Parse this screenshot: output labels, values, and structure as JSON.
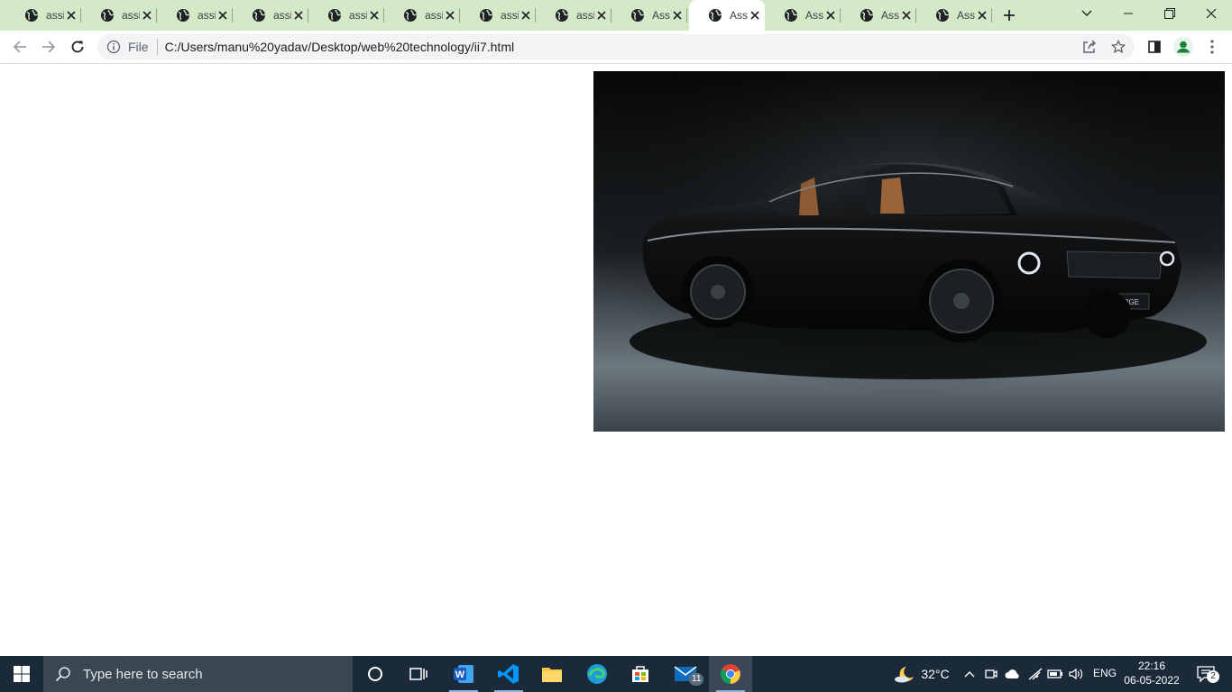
{
  "browser": {
    "tabs": [
      {
        "label": "assi",
        "active": false
      },
      {
        "label": "assi",
        "active": false
      },
      {
        "label": "assi",
        "active": false
      },
      {
        "label": "assi",
        "active": false
      },
      {
        "label": "assi",
        "active": false
      },
      {
        "label": "assi",
        "active": false
      },
      {
        "label": "assi",
        "active": false
      },
      {
        "label": "assi",
        "active": false
      },
      {
        "label": "Ass",
        "active": false
      },
      {
        "label": "Ass",
        "active": true
      },
      {
        "label": "Ass",
        "active": false
      },
      {
        "label": "Ass",
        "active": false
      },
      {
        "label": "Ass",
        "active": false
      }
    ],
    "address": {
      "scheme_label": "File",
      "url": "C:/Users/manu%20yadav/Desktop/web%20technology/ii7.html"
    }
  },
  "page": {
    "image_text": "CHARGE"
  },
  "taskbar": {
    "search_placeholder": "Type here to search",
    "mail_badge": "11",
    "weather": "32°C",
    "language": "ENG",
    "time": "22:16",
    "date": "06-05-2022",
    "notification_count": "2"
  },
  "colors": {
    "tabbar_bg": "#d3e9c8",
    "taskbar_bg": "#1b2a3a",
    "avatar_green": "#188038"
  }
}
